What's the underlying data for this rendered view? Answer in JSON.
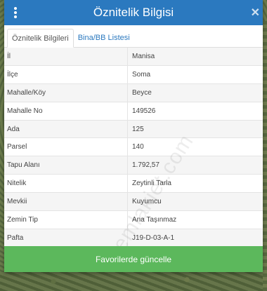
{
  "header": {
    "title": "Öznitelik Bilgisi",
    "close_glyph": "✕"
  },
  "tabs": [
    {
      "label": "Öznitelik Bilgileri"
    },
    {
      "label": "Bina/BB Listesi"
    }
  ],
  "attributes": [
    {
      "key": "İl",
      "value": "Manisa"
    },
    {
      "key": "İlçe",
      "value": "Soma"
    },
    {
      "key": "Mahalle/Köy",
      "value": "Beyce"
    },
    {
      "key": "Mahalle No",
      "value": "149526"
    },
    {
      "key": "Ada",
      "value": "125"
    },
    {
      "key": "Parsel",
      "value": "140"
    },
    {
      "key": "Tapu Alanı",
      "value": "1.792,57"
    },
    {
      "key": "Nitelik",
      "value": "Zeytinli Tarla"
    },
    {
      "key": "Mevkii",
      "value": "Kuyumcu"
    },
    {
      "key": "Zemin Tip",
      "value": "Ana Taşınmaz"
    },
    {
      "key": "Pafta",
      "value": "J19-D-03-A-1"
    }
  ],
  "watermark": "emlakjet.com",
  "footer": {
    "button_label": "Favorilerde güncelle"
  },
  "colors": {
    "header": "#2b79bf",
    "button": "#5cb85c"
  }
}
